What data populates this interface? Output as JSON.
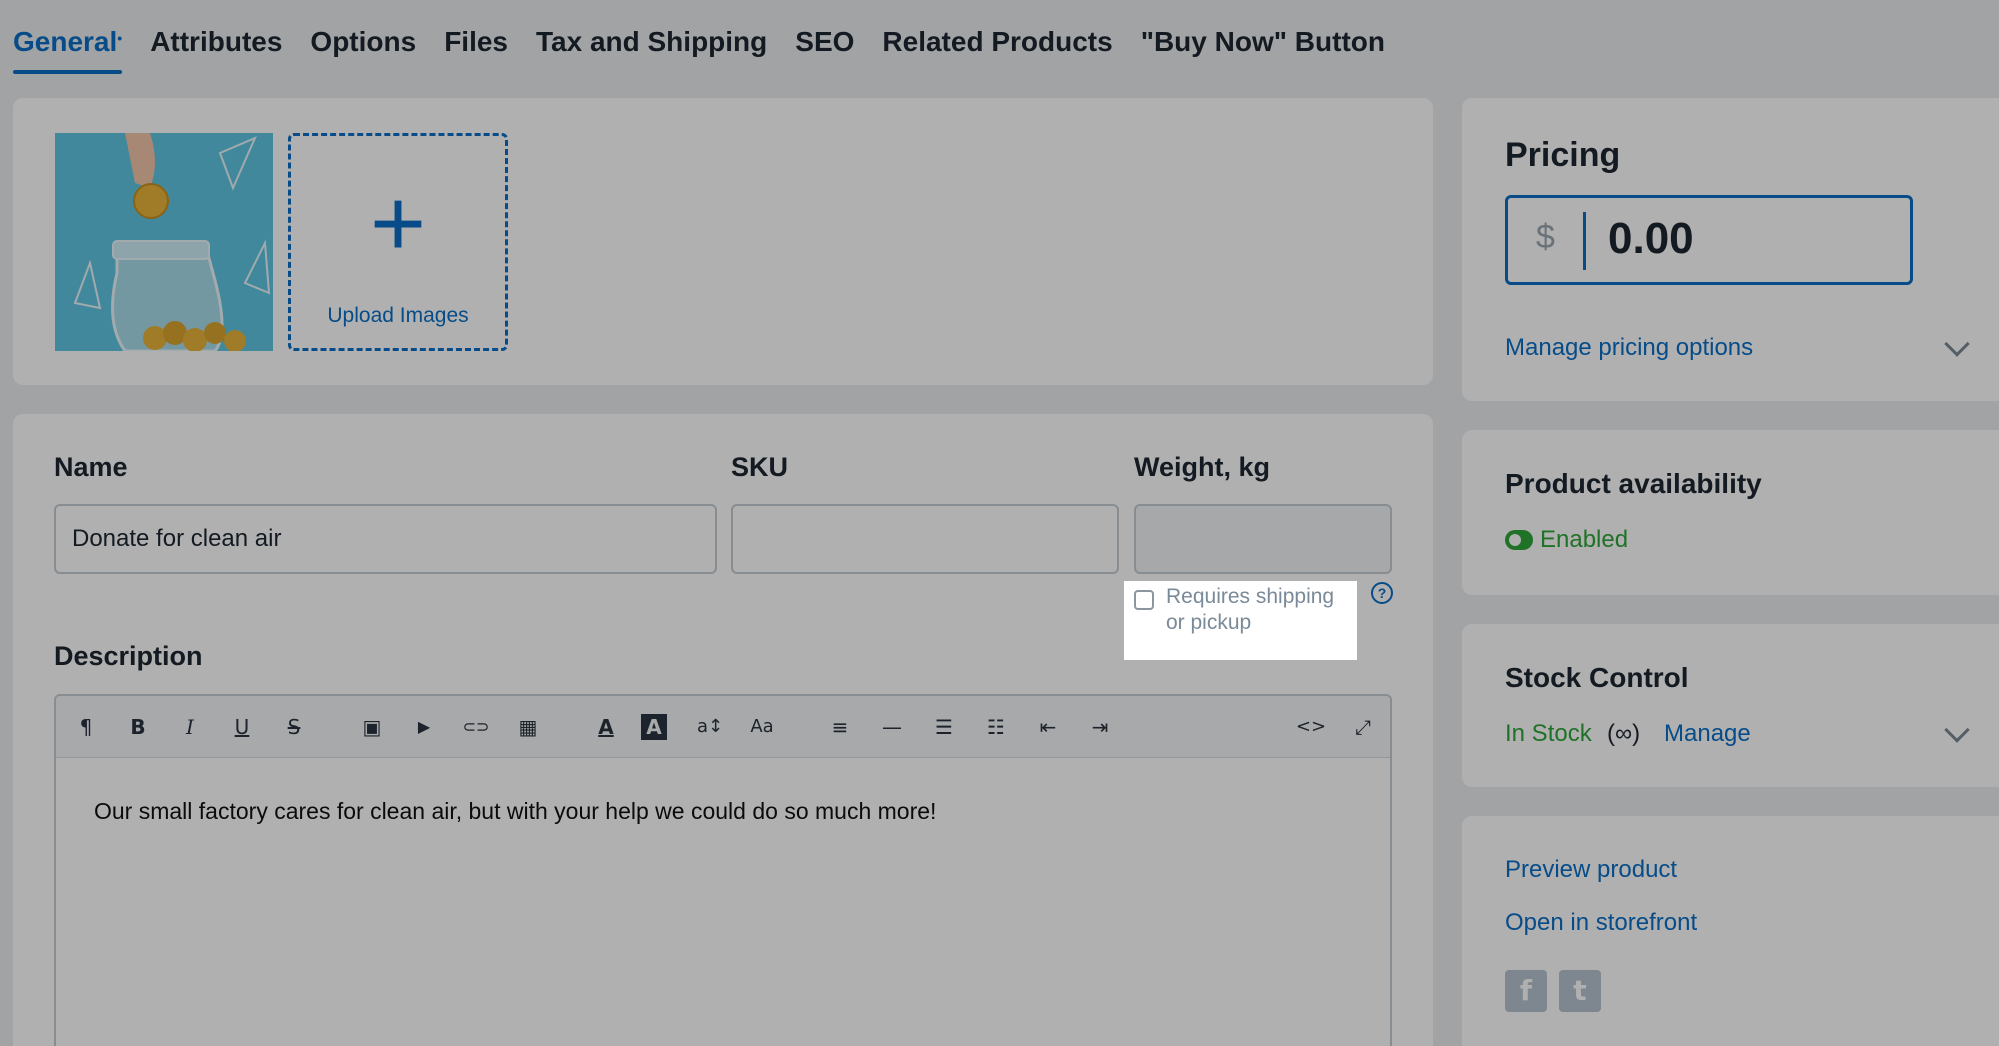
{
  "tabs": [
    {
      "label": "General",
      "dot": "•"
    },
    {
      "label": "Attributes"
    },
    {
      "label": "Options"
    },
    {
      "label": "Files"
    },
    {
      "label": "Tax and Shipping"
    },
    {
      "label": "SEO"
    },
    {
      "label": "Related Products"
    },
    {
      "label": "\"Buy Now\" Button"
    }
  ],
  "images": {
    "upload_label": "Upload Images",
    "plus": "+"
  },
  "form": {
    "name_label": "Name",
    "name_value": "Donate for clean air",
    "sku_label": "SKU",
    "sku_value": "",
    "weight_label": "Weight, kg",
    "weight_value": "",
    "requires_shipping_label": "Requires shipping or pickup",
    "help_icon": "?"
  },
  "description": {
    "label": "Description",
    "text": "Our small factory cares for clean air, but with your help we could do so much more!",
    "toolbar": {
      "paragraph": "¶",
      "bold": "B",
      "italic": "I",
      "underline": "U",
      "strike": "S",
      "image": "▣",
      "video": "▶",
      "link": "⊂⊃",
      "table": "▦",
      "font_color": "A",
      "bg_color": "A",
      "line_height": "a↕",
      "font_size": "Aa",
      "align": "≡",
      "hr": "—",
      "ul": "☰",
      "ol": "☷",
      "outdent": "⇤",
      "indent": "⇥",
      "code": "<>",
      "fullscreen": "⤢"
    }
  },
  "pricing": {
    "title": "Pricing",
    "currency": "$",
    "value": "0.00",
    "manage_link": "Manage pricing options"
  },
  "availability": {
    "title": "Product availability",
    "status": "Enabled",
    "status_color": "#2ea53a"
  },
  "stock": {
    "title": "Stock Control",
    "status": "In Stock",
    "quantity": "(∞)",
    "manage_link": "Manage"
  },
  "links": {
    "preview": "Preview product",
    "storefront": "Open in storefront",
    "facebook": "f",
    "twitter": "t"
  },
  "colors": {
    "accent": "#0b6fc6",
    "success": "#2ea53a"
  }
}
